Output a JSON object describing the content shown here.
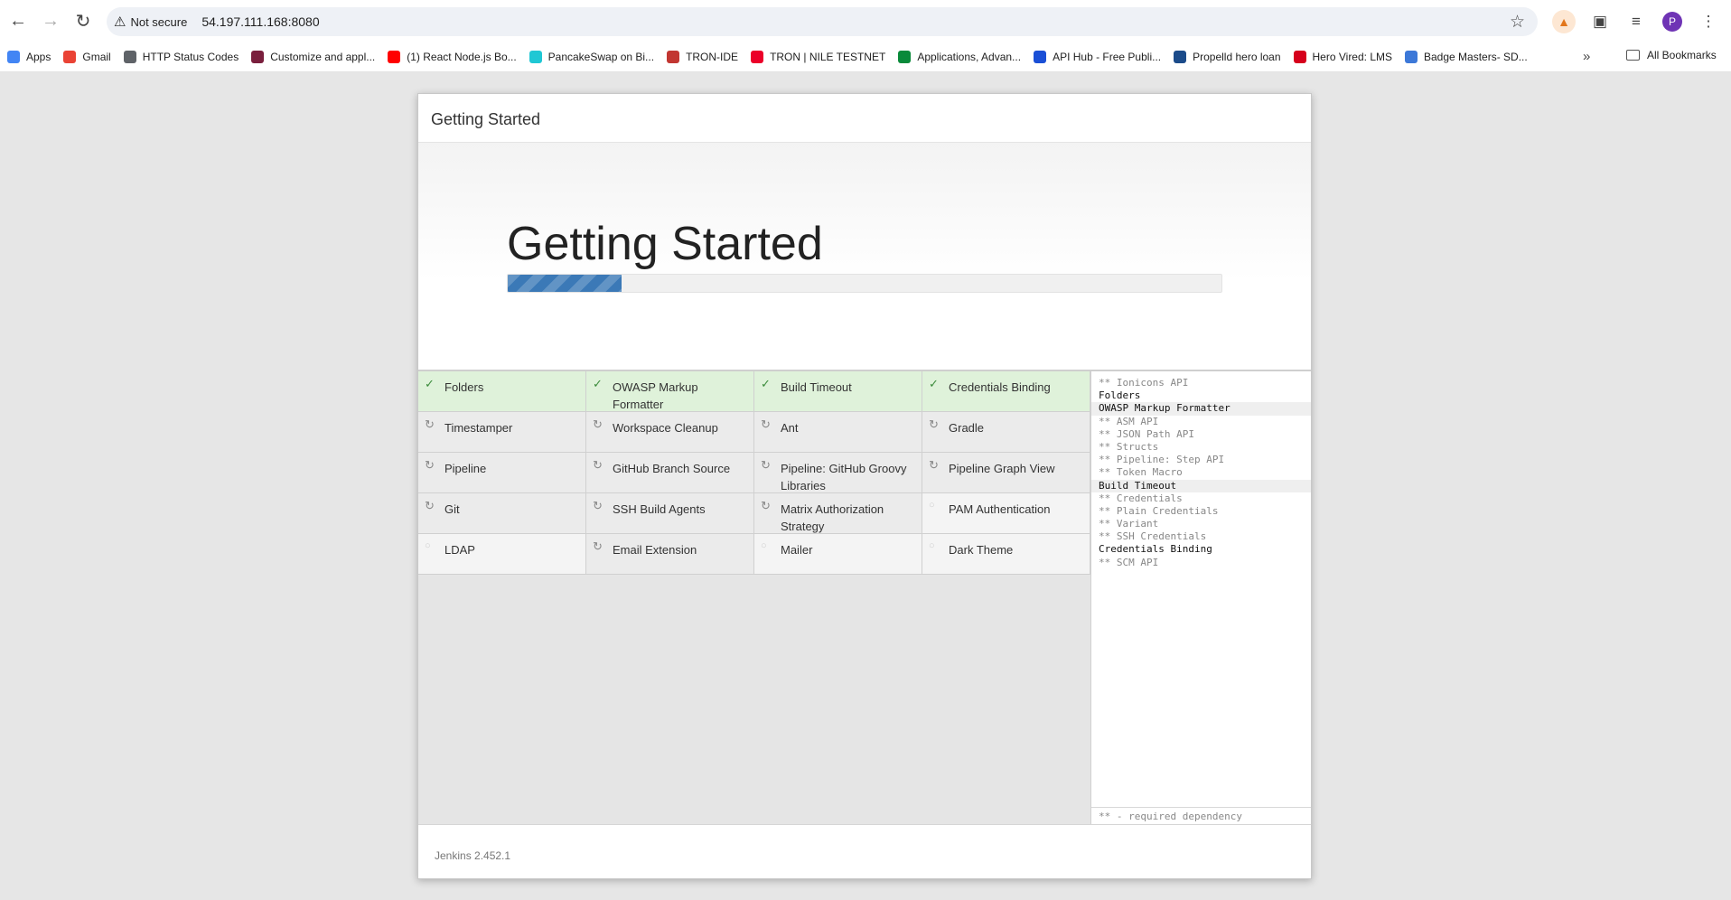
{
  "browser": {
    "security_label": "Not secure",
    "url": "54.197.111.168:8080",
    "profile_initial": "P"
  },
  "bookmarks": {
    "items": [
      {
        "label": "Apps",
        "icon": "apps-grid-icon",
        "color": "#4285f4"
      },
      {
        "label": "Gmail",
        "icon": "gmail-icon",
        "color": "#ea4335"
      },
      {
        "label": "HTTP Status Codes",
        "icon": "globe-icon",
        "color": "#5f6368"
      },
      {
        "label": "Customize and appl...",
        "icon": "site-icon",
        "color": "#7a1f3d"
      },
      {
        "label": "(1) React Node.js Bo...",
        "icon": "youtube-icon",
        "color": "#ff0000"
      },
      {
        "label": "PancakeSwap on Bi...",
        "icon": "pancakeswap-icon",
        "color": "#1fc7d4"
      },
      {
        "label": "TRON-IDE",
        "icon": "tron-ide-icon",
        "color": "#c23631"
      },
      {
        "label": "TRON | NILE TESTNET",
        "icon": "tron-icon",
        "color": "#eb0029"
      },
      {
        "label": "Applications, Advan...",
        "icon": "site-icon",
        "color": "#0a8a3a"
      },
      {
        "label": "API Hub - Free Publi...",
        "icon": "api-hub-icon",
        "color": "#1a4fd6"
      },
      {
        "label": "Propelld hero loan",
        "icon": "propelld-icon",
        "color": "#1b4b8a"
      },
      {
        "label": "Hero Vired: LMS",
        "icon": "hero-vired-icon",
        "color": "#d6001c"
      },
      {
        "label": "Badge Masters- SD...",
        "icon": "badge-icon",
        "color": "#3c78d8"
      }
    ],
    "all_label": "All Bookmarks"
  },
  "dialog": {
    "header_title": "Getting Started",
    "jumbo_title": "Getting Started",
    "progress": 0.16,
    "accent_color": "#3b79b7",
    "version": "Jenkins 2.452.1"
  },
  "plugins": [
    {
      "name": "Folders",
      "status": "success"
    },
    {
      "name": "OWASP Markup Formatter",
      "status": "success"
    },
    {
      "name": "Build Timeout",
      "status": "success"
    },
    {
      "name": "Credentials Binding",
      "status": "success"
    },
    {
      "name": "Timestamper",
      "status": "installing"
    },
    {
      "name": "Workspace Cleanup",
      "status": "installing"
    },
    {
      "name": "Ant",
      "status": "installing"
    },
    {
      "name": "Gradle",
      "status": "installing"
    },
    {
      "name": "Pipeline",
      "status": "installing"
    },
    {
      "name": "GitHub Branch Source",
      "status": "installing"
    },
    {
      "name": "Pipeline: GitHub Groovy Libraries",
      "status": "installing"
    },
    {
      "name": "Pipeline Graph View",
      "status": "installing"
    },
    {
      "name": "Git",
      "status": "installing"
    },
    {
      "name": "SSH Build Agents",
      "status": "installing"
    },
    {
      "name": "Matrix Authorization Strategy",
      "status": "installing"
    },
    {
      "name": "PAM Authentication",
      "status": "pending"
    },
    {
      "name": "LDAP",
      "status": "pending"
    },
    {
      "name": "Email Extension",
      "status": "installing"
    },
    {
      "name": "Mailer",
      "status": "pending"
    },
    {
      "name": "Dark Theme",
      "status": "pending"
    }
  ],
  "log": {
    "lines": [
      {
        "text": "** Ionicons API",
        "type": "dep"
      },
      {
        "text": "Folders",
        "type": "main"
      },
      {
        "text": "OWASP Markup Formatter",
        "type": "main-hl"
      },
      {
        "text": "** ASM API",
        "type": "dep"
      },
      {
        "text": "** JSON Path API",
        "type": "dep"
      },
      {
        "text": "** Structs",
        "type": "dep"
      },
      {
        "text": "** Pipeline: Step API",
        "type": "dep"
      },
      {
        "text": "** Token Macro",
        "type": "dep"
      },
      {
        "text": "Build Timeout",
        "type": "main-hl"
      },
      {
        "text": "** Credentials",
        "type": "dep"
      },
      {
        "text": "** Plain Credentials",
        "type": "dep"
      },
      {
        "text": "** Variant",
        "type": "dep"
      },
      {
        "text": "** SSH Credentials",
        "type": "dep"
      },
      {
        "text": "Credentials Binding",
        "type": "main"
      },
      {
        "text": "** SCM API",
        "type": "dep"
      }
    ],
    "footer": "** - required dependency"
  }
}
